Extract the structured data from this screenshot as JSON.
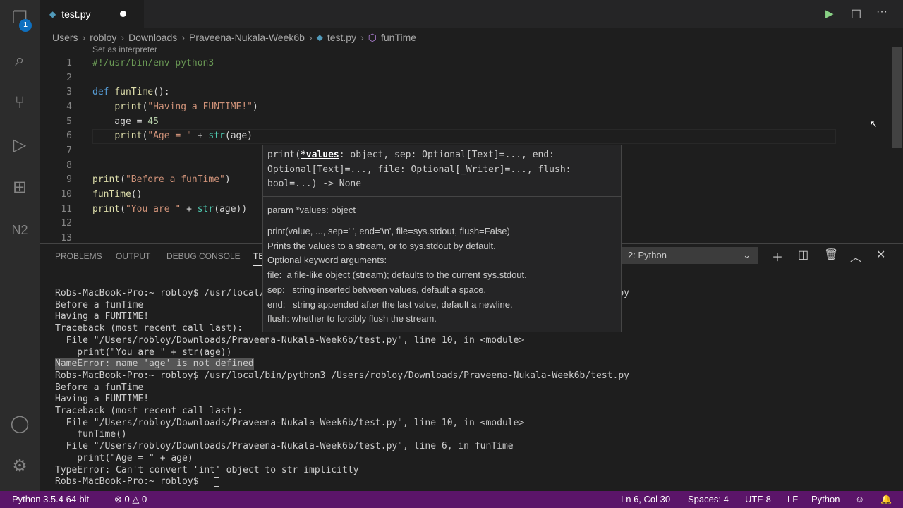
{
  "activity": {
    "explorer_badge": "1"
  },
  "tab": {
    "label": "test.py"
  },
  "breadcrumb": [
    "Users",
    "robloy",
    "Downloads",
    "Praveena-Nukala-Week6b",
    "test.py",
    "funTime"
  ],
  "codelens": "Set as interpreter",
  "code_lines": [
    {
      "n": "1",
      "html": "<span class='cm'>#!/usr/bin/env python3</span>"
    },
    {
      "n": "2",
      "html": ""
    },
    {
      "n": "3",
      "html": "<span class='kw'>def</span> <span class='fn'>funTime</span>():"
    },
    {
      "n": "4",
      "html": "    <span class='fn'>print</span>(<span class='st'>\"Having a FUNTIME!\"</span>)"
    },
    {
      "n": "5",
      "html": "    age = <span class='nm'>45</span>"
    },
    {
      "n": "6",
      "html": "    <span class='fn'>print</span>(<span class='st'>\"Age = \"</span> + <span class='bi'>str</span>(age)"
    },
    {
      "n": "7",
      "html": ""
    },
    {
      "n": "8",
      "html": ""
    },
    {
      "n": "9",
      "html": "<span class='fn'>print</span>(<span class='st'>\"Before a funTime\"</span>)"
    },
    {
      "n": "10",
      "html": "<span class='fn'>funTime</span>()"
    },
    {
      "n": "11",
      "html": "<span class='fn'>print</span>(<span class='st'>\"You are \"</span> + <span class='bi'>str</span>(age))"
    },
    {
      "n": "12",
      "html": ""
    },
    {
      "n": "13",
      "html": ""
    }
  ],
  "panel": {
    "tabs": [
      "PROBLEMS",
      "OUTPUT",
      "DEBUG CONSOLE",
      "TERMINAL"
    ],
    "terminal_select": "2: Python"
  },
  "terminal": [
    "Robs-MacBook-Pro:~ robloy$ /usr/local/bin/python3 /Users/robloy/Downloads/Praveena-Nukala-Week6b/test.py",
    "Before a funTime",
    "Having a FUNTIME!",
    "Traceback (most recent call last):",
    "  File \"/Users/robloy/Downloads/Praveena-Nukala-Week6b/test.py\", line 10, in <module>",
    "    print(\"You are \" + str(age))",
    "NameError: name 'age' is not defined",
    "Robs-MacBook-Pro:~ robloy$ /usr/local/bin/python3 /Users/robloy/Downloads/Praveena-Nukala-Week6b/test.py",
    "Before a funTime",
    "Having a FUNTIME!",
    "Traceback (most recent call last):",
    "  File \"/Users/robloy/Downloads/Praveena-Nukala-Week6b/test.py\", line 10, in <module>",
    "    funTime()",
    "  File \"/Users/robloy/Downloads/Praveena-Nukala-Week6b/test.py\", line 6, in funTime",
    "    print(\"Age = \" + age)",
    "TypeError: Can't convert 'int' object to str implicitly",
    "Robs-MacBook-Pro:~ robloy$ "
  ],
  "tooltip": {
    "signature_prefix": "print(",
    "signature_param": "*values",
    "signature_rest": ": object, sep: Optional[Text]=..., end: Optional[Text]=..., file: Optional[_Writer]=..., flush: bool=...) -> None",
    "param_doc": "param *values: object",
    "doc": [
      "print(value, ..., sep=' ', end='\\n', file=sys.stdout, flush=False)",
      "Prints the values to a stream, or to sys.stdout by default.",
      "Optional keyword arguments:",
      "file:  a file-like object (stream); defaults to the current sys.stdout.",
      "sep:   string inserted between values, default a space.",
      "end:   string appended after the last value, default a newline.",
      "flush: whether to forcibly flush the stream."
    ]
  },
  "status": {
    "interpreter": "Python 3.5.4 64-bit",
    "errors": "0",
    "warnings": "0",
    "position": "Ln 6, Col 30",
    "spaces": "Spaces: 4",
    "encoding": "UTF-8",
    "eol": "LF",
    "language": "Python"
  }
}
